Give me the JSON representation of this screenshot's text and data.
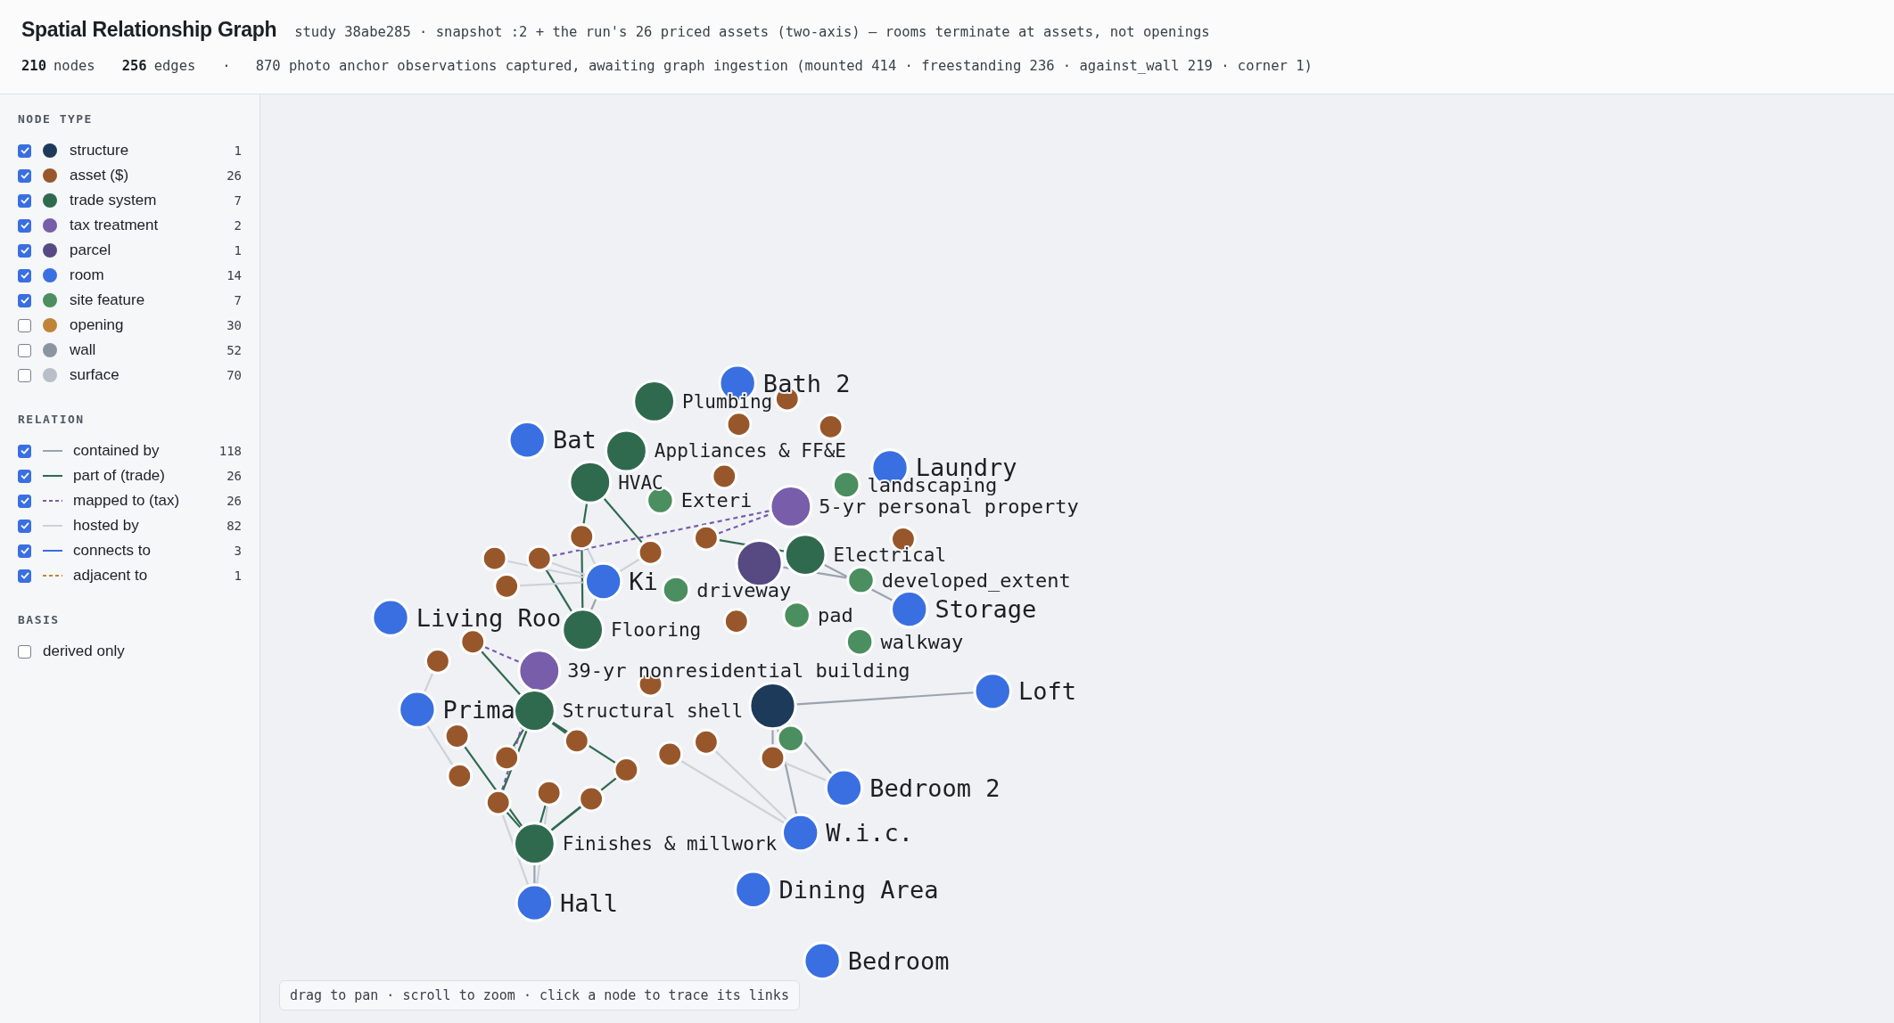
{
  "header": {
    "title": "Spatial Relationship Graph",
    "subtitle": "study 38abe285 · snapshot :2 + the run's 26 priced assets (two-axis) — rooms terminate at assets, not openings",
    "stats": [
      {
        "value": "210",
        "label": "nodes"
      },
      {
        "value": "256",
        "label": "edges"
      }
    ],
    "separator": "·",
    "note": "870 photo anchor observations captured, awaiting graph ingestion (mounted 414 · freestanding 236 · against_wall 219 · corner 1)"
  },
  "sidebar": {
    "node_type_title": "NODE TYPE",
    "node_types": [
      {
        "label": "structure",
        "count": "1",
        "checked": true,
        "color": "#1d3a5a"
      },
      {
        "label": "asset ($)",
        "count": "26",
        "checked": true,
        "color": "#98572b"
      },
      {
        "label": "trade system",
        "count": "7",
        "checked": true,
        "color": "#2f6a4f"
      },
      {
        "label": "tax treatment",
        "count": "2",
        "checked": true,
        "color": "#775daa"
      },
      {
        "label": "parcel",
        "count": "1",
        "checked": true,
        "color": "#574a82"
      },
      {
        "label": "room",
        "count": "14",
        "checked": true,
        "color": "#3a6fe2"
      },
      {
        "label": "site feature",
        "count": "7",
        "checked": true,
        "color": "#4b8e5f"
      },
      {
        "label": "opening",
        "count": "30",
        "checked": false,
        "color": "#bf8436"
      },
      {
        "label": "wall",
        "count": "52",
        "checked": false,
        "color": "#8b95a2"
      },
      {
        "label": "surface",
        "count": "70",
        "checked": false,
        "color": "#b8bfc8"
      }
    ],
    "relation_title": "RELATION",
    "relations": [
      {
        "label": "contained by",
        "count": "118",
        "checked": true,
        "color": "#9aa3ae",
        "dashed": false
      },
      {
        "label": "part of (trade)",
        "count": "26",
        "checked": true,
        "color": "#2f6a4f",
        "dashed": false
      },
      {
        "label": "mapped to (tax)",
        "count": "26",
        "checked": true,
        "color": "#775daa",
        "dashed": true
      },
      {
        "label": "hosted by",
        "count": "82",
        "checked": true,
        "color": "#cdd2d8",
        "dashed": false
      },
      {
        "label": "connects to",
        "count": "3",
        "checked": true,
        "color": "#3a6fe2",
        "dashed": false
      },
      {
        "label": "adjacent to",
        "count": "1",
        "checked": true,
        "color": "#c8842f",
        "dashed": true
      }
    ],
    "basis_title": "BASIS",
    "basis": [
      {
        "label": "derived only",
        "checked": false
      }
    ]
  },
  "graph": {
    "nodes": [
      {
        "kind": "room",
        "label": "Bath 2",
        "color": "#3a6fe2"
      },
      {
        "kind": "trade",
        "label": "Plumbing",
        "color": "#2f6a4f"
      },
      {
        "kind": "room",
        "label": "Bat",
        "color": "#3a6fe2"
      },
      {
        "kind": "trade",
        "label": "Appliances & FF&E",
        "color": "#2f6a4f"
      },
      {
        "kind": "room",
        "label": "Laundry",
        "color": "#3a6fe2"
      },
      {
        "kind": "trade",
        "label": "HVAC",
        "color": "#2f6a4f"
      },
      {
        "kind": "site",
        "label": "Exteri",
        "color": "#4b8e5f"
      },
      {
        "kind": "site",
        "label": "landscaping",
        "color": "#4b8e5f"
      },
      {
        "kind": "tax",
        "label": "5-yr personal property",
        "color": "#775daa"
      },
      {
        "kind": "trade",
        "label": "Electrical",
        "color": "#2f6a4f"
      },
      {
        "kind": "parcel",
        "color": "#574a82"
      },
      {
        "kind": "room",
        "label": "Ki",
        "color": "#3a6fe2"
      },
      {
        "kind": "site",
        "label": "driveway",
        "color": "#4b8e5f"
      },
      {
        "kind": "site",
        "label": "developed_extent",
        "color": "#4b8e5f"
      },
      {
        "kind": "room",
        "label": "Living Roo",
        "color": "#3a6fe2"
      },
      {
        "kind": "room",
        "label": "Storage",
        "color": "#3a6fe2"
      },
      {
        "kind": "trade",
        "label": "Flooring",
        "color": "#2f6a4f"
      },
      {
        "kind": "site",
        "label": "pad",
        "color": "#4b8e5f"
      },
      {
        "kind": "site",
        "label": "walkway",
        "color": "#4b8e5f"
      },
      {
        "kind": "site",
        "color": "#4b8e5f"
      },
      {
        "kind": "tax",
        "label": "39-yr nonresidential building",
        "color": "#775daa"
      },
      {
        "kind": "structure",
        "color": "#1d3a5a"
      },
      {
        "kind": "room",
        "label": "Loft",
        "color": "#3a6fe2"
      },
      {
        "kind": "room",
        "label": "Prima",
        "color": "#3a6fe2"
      },
      {
        "kind": "trade",
        "label": "Structural shell",
        "color": "#2f6a4f"
      },
      {
        "kind": "room",
        "label": "Bedroom 2",
        "color": "#3a6fe2"
      },
      {
        "kind": "room",
        "label": "W.i.c.",
        "color": "#3a6fe2"
      },
      {
        "kind": "trade",
        "label": "Finishes & millwork",
        "color": "#2f6a4f"
      },
      {
        "kind": "room",
        "label": "Dining Area",
        "color": "#3a6fe2"
      },
      {
        "kind": "room",
        "label": "Hall",
        "color": "#3a6fe2"
      },
      {
        "kind": "room",
        "label": "Bedroom",
        "color": "#3a6fe2"
      },
      {
        "kind": "asset",
        "color": "#98572b"
      },
      {
        "kind": "asset",
        "color": "#98572b"
      },
      {
        "kind": "asset",
        "color": "#98572b"
      },
      {
        "kind": "asset",
        "color": "#98572b"
      },
      {
        "kind": "asset",
        "color": "#98572b"
      },
      {
        "kind": "asset",
        "color": "#98572b"
      },
      {
        "kind": "asset",
        "color": "#98572b"
      },
      {
        "kind": "asset",
        "color": "#98572b"
      },
      {
        "kind": "asset",
        "color": "#98572b"
      },
      {
        "kind": "asset",
        "color": "#98572b"
      },
      {
        "kind": "asset",
        "color": "#98572b"
      },
      {
        "kind": "asset",
        "color": "#98572b"
      },
      {
        "kind": "asset",
        "color": "#98572b"
      },
      {
        "kind": "asset",
        "color": "#98572b"
      },
      {
        "kind": "asset",
        "color": "#98572b"
      },
      {
        "kind": "asset",
        "color": "#98572b"
      },
      {
        "kind": "asset",
        "color": "#98572b"
      },
      {
        "kind": "asset",
        "color": "#98572b"
      },
      {
        "kind": "asset",
        "color": "#98572b"
      },
      {
        "kind": "asset",
        "color": "#98572b"
      },
      {
        "kind": "asset",
        "color": "#98572b"
      },
      {
        "kind": "asset",
        "color": "#98572b"
      },
      {
        "kind": "asset",
        "color": "#98572b"
      },
      {
        "kind": "asset",
        "color": "#98572b"
      },
      {
        "kind": "asset",
        "color": "#98572b"
      },
      {
        "kind": "asset",
        "color": "#98572b"
      }
    ],
    "hint": "drag to pan · scroll to zoom · click a node to trace its links"
  }
}
